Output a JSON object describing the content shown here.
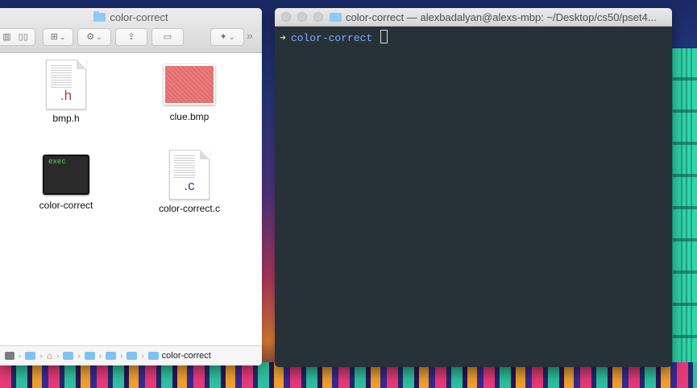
{
  "finder": {
    "title": "color-correct",
    "toolbar": {
      "view_icon": "▥",
      "column_icon": "▯▯",
      "arrange_icon": "⊞",
      "action_icon": "⚙",
      "share_icon": "⇪",
      "tag_icon": "▭",
      "dropbox_icon": "✦",
      "more": "»"
    },
    "files": [
      {
        "name": "bmp.h",
        "ext": ".h",
        "ext_color": "#c0392b",
        "kind": "document"
      },
      {
        "name": "clue.bmp",
        "kind": "image"
      },
      {
        "name": "color-correct",
        "exec_label": "exec",
        "kind": "executable"
      },
      {
        "name": "color-correct.c",
        "ext": ".c",
        "ext_color": "#5b2a86",
        "kind": "document"
      }
    ],
    "path": [
      "color-correct"
    ]
  },
  "terminal": {
    "title": "color-correct — alexbadalyan@alexs-mbp: ~/Desktop/cs50/pset4...",
    "prompt_arrow": "➜",
    "cwd": "color-correct"
  }
}
